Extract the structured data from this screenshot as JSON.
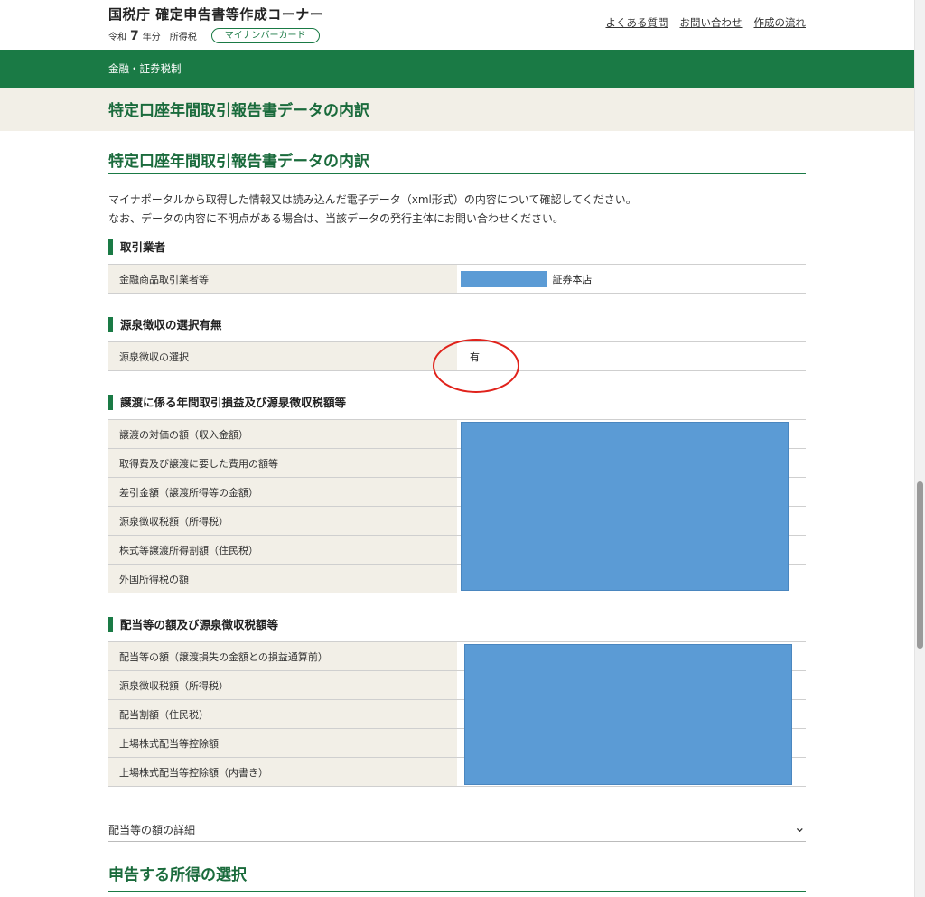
{
  "header": {
    "site_title": "国税庁 確定申告書等作成コーナー",
    "era": "令和",
    "year": "7",
    "year_unit": "年分",
    "tax_type": "所得税",
    "mynumber_label": "マイナンバーカード",
    "links": [
      "よくある質問",
      "お問い合わせ",
      "作成の流れ"
    ]
  },
  "nav": {
    "category": "金融・証券税制"
  },
  "page_title": "特定口座年間取引報告書データの内訳",
  "main": {
    "section_title": "特定口座年間取引報告書データの内訳",
    "intro_lines": [
      "マイナポータルから取得した情報又は読み込んだ電子データ（xml形式）の内容について確認してください。",
      "なお、データの内容に不明点がある場合は、当該データの発行主体にお問い合わせください。"
    ],
    "broker": {
      "heading": "取引業者",
      "row_label": "金融商品取引業者等",
      "value_suffix": "証券本店"
    },
    "withholding": {
      "heading": "源泉徴収の選択有無",
      "row_label": "源泉徴収の選択",
      "value": "有"
    },
    "transfer": {
      "heading": "譲渡に係る年間取引損益及び源泉徴収税額等",
      "rows": [
        "譲渡の対価の額（収入金額）",
        "取得費及び譲渡に要した費用の額等",
        "差引金額（譲渡所得等の金額）",
        "源泉徴収税額（所得税）",
        "株式等譲渡所得割額（住民税）",
        "外国所得税の額"
      ]
    },
    "dividend": {
      "heading": "配当等の額及び源泉徴収税額等",
      "rows": [
        "配当等の額（譲渡損失の金額との損益通算前）",
        "源泉徴収税額（所得税）",
        "配当割額（住民税）",
        "上場株式配当等控除額",
        "上場株式配当等控除額（内書き）"
      ]
    },
    "dividend_details_label": "配当等の額の詳細",
    "next_section_title": "申告する所得の選択"
  },
  "colors": {
    "green": "#1a7a45",
    "beige": "#f2efe7",
    "redaction": "#5b9bd5",
    "annotation": "#e0221b"
  }
}
